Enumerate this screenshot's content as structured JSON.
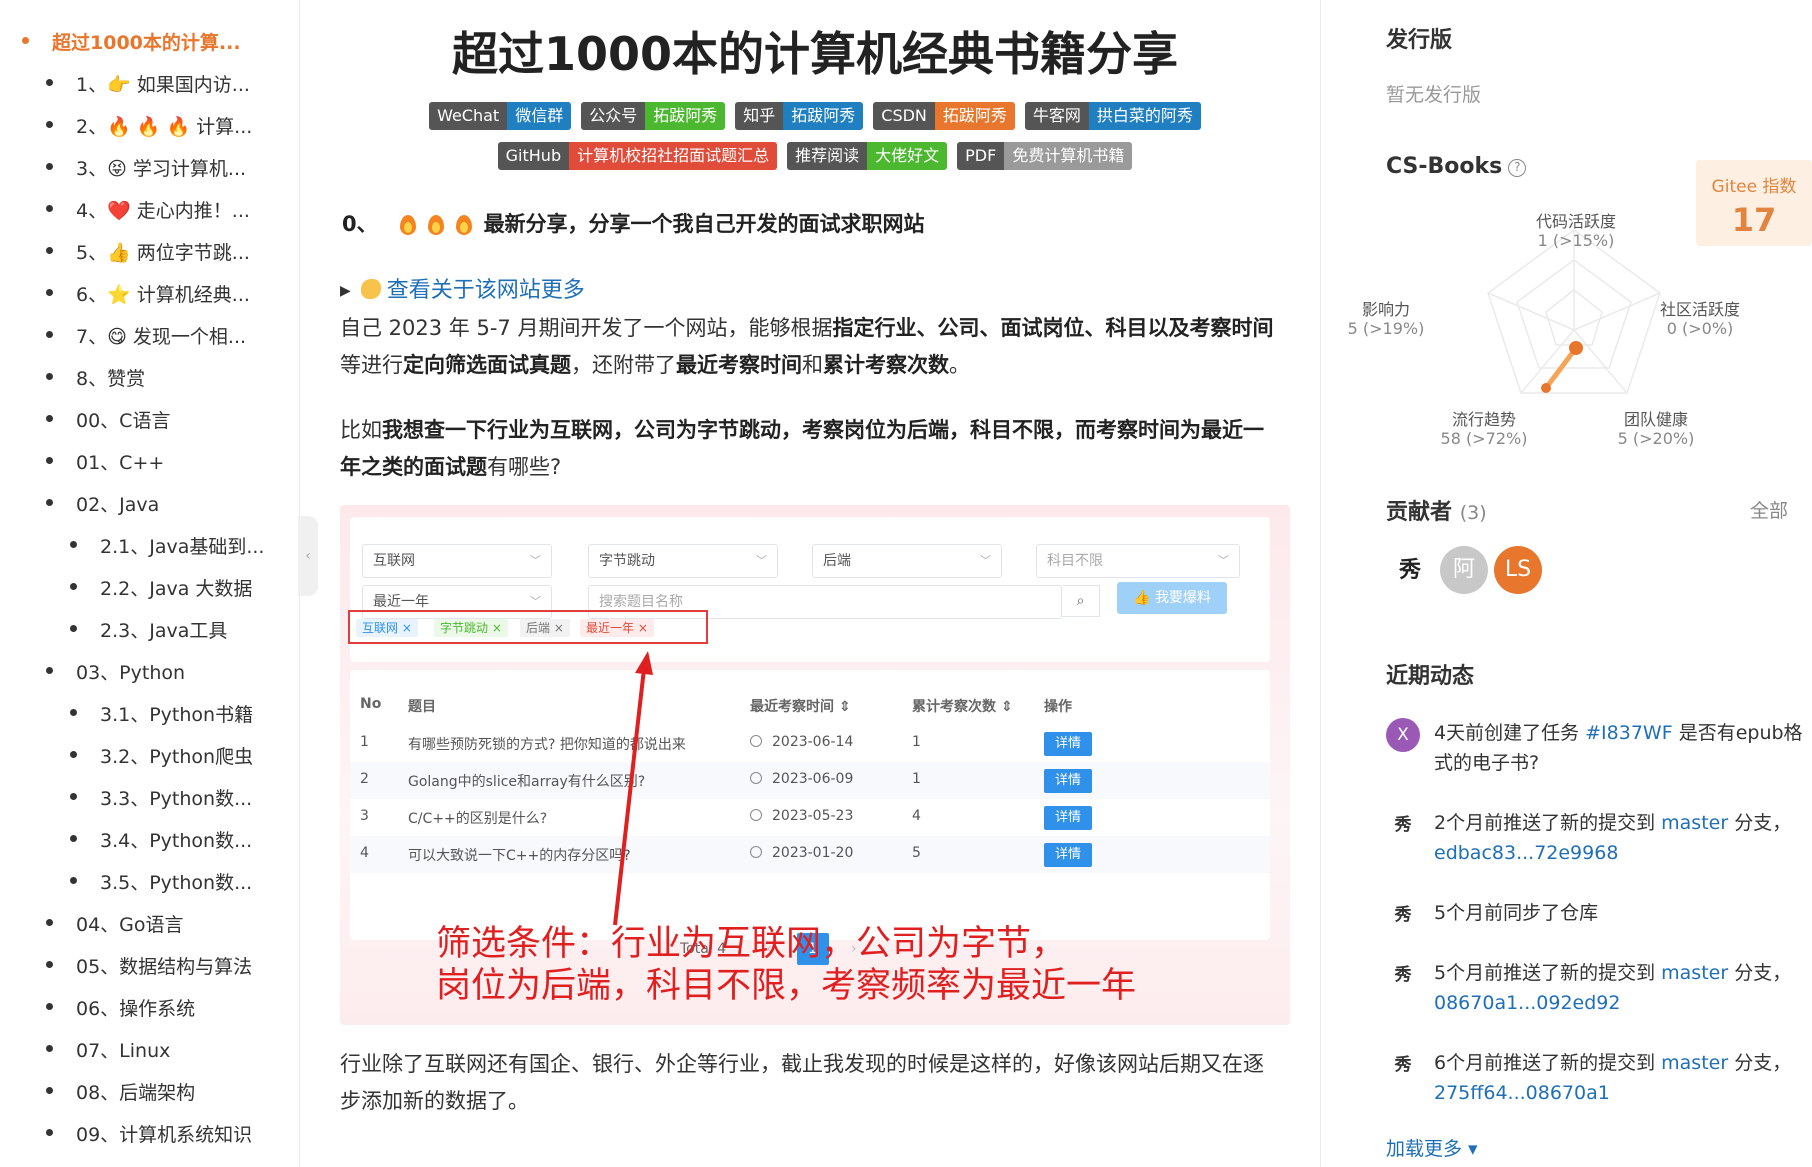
{
  "toc": {
    "items": [
      {
        "label": "超过1000本的计算...",
        "level": 0,
        "active": true
      },
      {
        "label": "1、👉 如果国内访...",
        "level": 1
      },
      {
        "label": "2、🔥 🔥 🔥 计算...",
        "level": 1
      },
      {
        "label": "3、😝 学习计算机...",
        "level": 1
      },
      {
        "label": "4、❤️ 走心内推！...",
        "level": 1
      },
      {
        "label": "5、👍 两位字节跳...",
        "level": 1
      },
      {
        "label": "6、⭐ 计算机经典...",
        "level": 1
      },
      {
        "label": "7、😋 发现一个相...",
        "level": 1
      },
      {
        "label": "8、赞赏",
        "level": 1
      },
      {
        "label": "00、C语言",
        "level": 1
      },
      {
        "label": "01、C++",
        "level": 1
      },
      {
        "label": "02、Java",
        "level": 1
      },
      {
        "label": "2.1、Java基础到...",
        "level": 2
      },
      {
        "label": "2.2、Java 大数据",
        "level": 2
      },
      {
        "label": "2.3、Java工具",
        "level": 2
      },
      {
        "label": "03、Python",
        "level": 1
      },
      {
        "label": "3.1、Python书籍",
        "level": 2
      },
      {
        "label": "3.2、Python爬虫",
        "level": 2
      },
      {
        "label": "3.3、Python数...",
        "level": 2
      },
      {
        "label": "3.4、Python数...",
        "level": 2
      },
      {
        "label": "3.5、Python数...",
        "level": 2
      },
      {
        "label": "04、Go语言",
        "level": 1
      },
      {
        "label": "05、数据结构与算法",
        "level": 1
      },
      {
        "label": "06、操作系统",
        "level": 1
      },
      {
        "label": "07、Linux",
        "level": 1
      },
      {
        "label": "08、后端架构",
        "level": 1
      },
      {
        "label": "09、计算机系统知识",
        "level": 1
      }
    ],
    "collapse_icon": "chevron-left-icon"
  },
  "article": {
    "title": "超过1000本的计算机经典书籍分享",
    "badges_row1": [
      {
        "k": "WeChat",
        "v": "微信群",
        "color": "#1f7fc0"
      },
      {
        "k": "公众号",
        "v": "拓跋阿秀",
        "color": "#4cb82f"
      },
      {
        "k": "知乎",
        "v": "拓跋阿秀",
        "color": "#1f7fc0"
      },
      {
        "k": "CSDN",
        "v": "拓跋阿秀",
        "color": "#e8762d"
      },
      {
        "k": "牛客网",
        "v": "拱白菜的阿秀",
        "color": "#1f7fc0"
      }
    ],
    "badges_row2": [
      {
        "k": "GitHub",
        "v": "计算机校招社招面试题汇总",
        "color": "#e04b3a"
      },
      {
        "k": "推荐阅读",
        "v": "大佬好文",
        "color": "#4cb82f"
      },
      {
        "k": "PDF",
        "v": "免费计算机书籍",
        "color": "#9a9a9a"
      }
    ],
    "share_prefix": "0、",
    "share_text": "最新分享，分享一个我自己开发的面试求职网站",
    "details_label": "查看关于该网站更多",
    "p1_html": "自己 2023 年 5-7 月期间开发了一个网站，能够根据<b>指定行业、公司、面试岗位、科目以及考察时间</b>等进行<b>定向筛选面试真题</b>，还附带了<b>最近考察时间</b>和<b>累计考察次数</b>。",
    "p2_html": "比如<b>我想查一下行业为互联网，公司为字节跳动，考察岗位为后端，科目不限，而考察时间为最近一年之类的面试题</b>有哪些?",
    "p3": "行业除了互联网还有国企、银行、外企等行业，截止我发现的时候是这样的，好像该网站后期又在逐步添加新的数据了。"
  },
  "shot": {
    "selects": [
      "互联网",
      "字节跳动",
      "后端",
      "科目不限"
    ],
    "time_select": "最近一年",
    "search_placeholder": "搜索题目名称",
    "report_button": "我要爆料",
    "tags": [
      {
        "label": "互联网 ×",
        "color": "#2f91e9",
        "bg": "#e8f3fd"
      },
      {
        "label": "字节跳动 ×",
        "color": "#4cb82f",
        "bg": "#ecf8e8"
      },
      {
        "label": "后端 ×",
        "color": "#777",
        "bg": "#f2f2f2"
      },
      {
        "label": "最近一年 ×",
        "color": "#e04b3a",
        "bg": "#fdeceb"
      }
    ],
    "headers": [
      "No",
      "题目",
      "最近考察时间 ⇕",
      "累计考察次数 ⇕",
      "操作"
    ],
    "rows": [
      {
        "no": "1",
        "q": "有哪些预防死锁的方式? 把你知道的都说出来",
        "date": "2023-06-14",
        "count": "1",
        "op": "详情"
      },
      {
        "no": "2",
        "q": "Golang中的slice和array有什么区别?",
        "date": "2023-06-09",
        "count": "1",
        "op": "详情"
      },
      {
        "no": "3",
        "q": "C/C++的区别是什么?",
        "date": "2023-05-23",
        "count": "4",
        "op": "详情"
      },
      {
        "no": "4",
        "q": "可以大致说一下C++的内存分区吗?",
        "date": "2023-01-20",
        "count": "5",
        "op": "详情"
      }
    ],
    "total": "Total 4",
    "page": "1",
    "caption_l1": "筛选条件：行业为互联网，公司为字节，",
    "caption_l2": "岗位为后端，科目不限，考察频率为最近一年"
  },
  "side": {
    "release_h": "发行版",
    "release_empty": "暂无发行版",
    "repo_h": "CS-Books",
    "gitee_label": "Gitee 指数",
    "gitee_value": "17",
    "radar": [
      {
        "name": "代码活跃度",
        "val": "1 (>15%)"
      },
      {
        "name": "社区活跃度",
        "val": "0 (>0%)"
      },
      {
        "name": "团队健康",
        "val": "5 (>20%)"
      },
      {
        "name": "流行趋势",
        "val": "58 (>72%)"
      },
      {
        "name": "影响力",
        "val": "5 (>19%)"
      }
    ],
    "contrib_h": "贡献者",
    "contrib_count": "(3)",
    "contrib_all": "全部",
    "avatars": [
      {
        "text": "秀",
        "bg": "#ffffff",
        "fg": "#222"
      },
      {
        "text": "阿",
        "bg": "#c8c8c8",
        "fg": "#fff"
      },
      {
        "text": "LS",
        "bg": "#e8762d",
        "fg": "#fff"
      }
    ],
    "activity_h": "近期动态",
    "feed": [
      {
        "icon": "X",
        "bg": "#9b59b6",
        "pre": "4天前创建了任务 ",
        "link": "#I837WF",
        "post": " 是否有epub格式的电子书?"
      },
      {
        "icon": "秀",
        "bg": "brush",
        "pre": "2个月前推送了新的提交到 ",
        "link": "master",
        "post": " 分支，",
        "link2": "edbac83...72e9968"
      },
      {
        "icon": "秀",
        "bg": "brush",
        "pre": "5个月前同步了仓库",
        "link": "",
        "post": ""
      },
      {
        "icon": "秀",
        "bg": "brush",
        "pre": "5个月前推送了新的提交到 ",
        "link": "master",
        "post": " 分支，",
        "link2": "08670a1...092ed92"
      },
      {
        "icon": "秀",
        "bg": "brush",
        "pre": "6个月前推送了新的提交到 ",
        "link": "master",
        "post": " 分支，",
        "link2": "275ff64...08670a1"
      }
    ],
    "load_more": "加载更多 ▾"
  },
  "colors": {
    "accent": "#e8762d",
    "link": "#1f6fb8",
    "primary": "#2f91e9",
    "annotation": "#e02020"
  }
}
